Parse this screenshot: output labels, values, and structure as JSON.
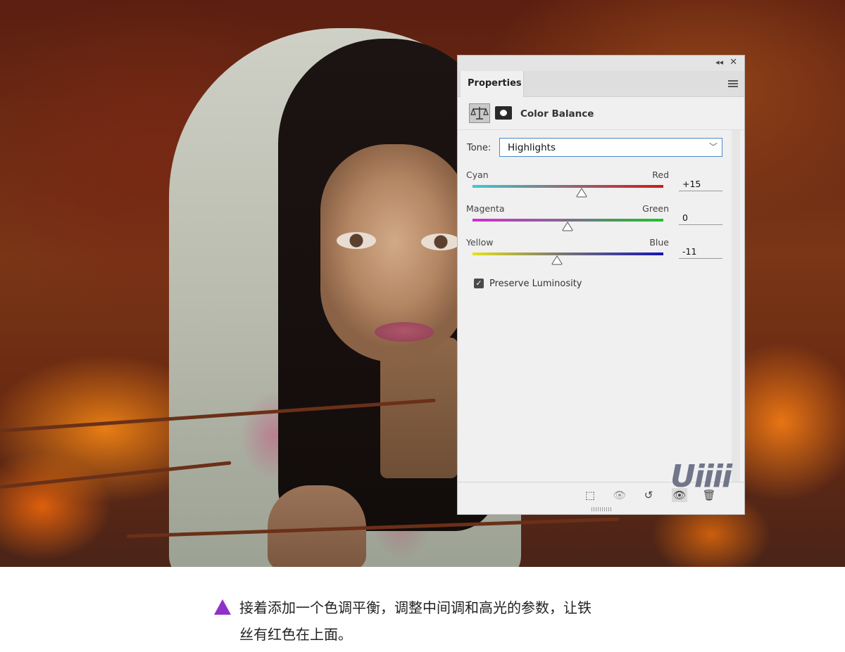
{
  "panel": {
    "tab_label": "Properties",
    "title": "Color Balance",
    "tone_label": "Tone:",
    "tone_value": "Highlights",
    "sliders": [
      {
        "left": "Cyan",
        "right": "Red",
        "value": "+15",
        "track_from": "#3ec9cf",
        "track_to": "#d21818"
      },
      {
        "left": "Magenta",
        "right": "Green",
        "value": "0",
        "track_from": "#d62ccf",
        "track_to": "#1ec42a"
      },
      {
        "left": "Yellow",
        "right": "Blue",
        "value": "-11",
        "track_from": "#e3e21a",
        "track_to": "#1414b8"
      }
    ],
    "preserve_label": "Preserve Luminosity",
    "preserve_checked": true
  },
  "watermark": "Uiiii",
  "caption": {
    "line1": "接着添加一个色调平衡，调整中间调和高光的参数，让铁",
    "line2": "丝有红色在上面。",
    "accent": "#8f32c9"
  }
}
